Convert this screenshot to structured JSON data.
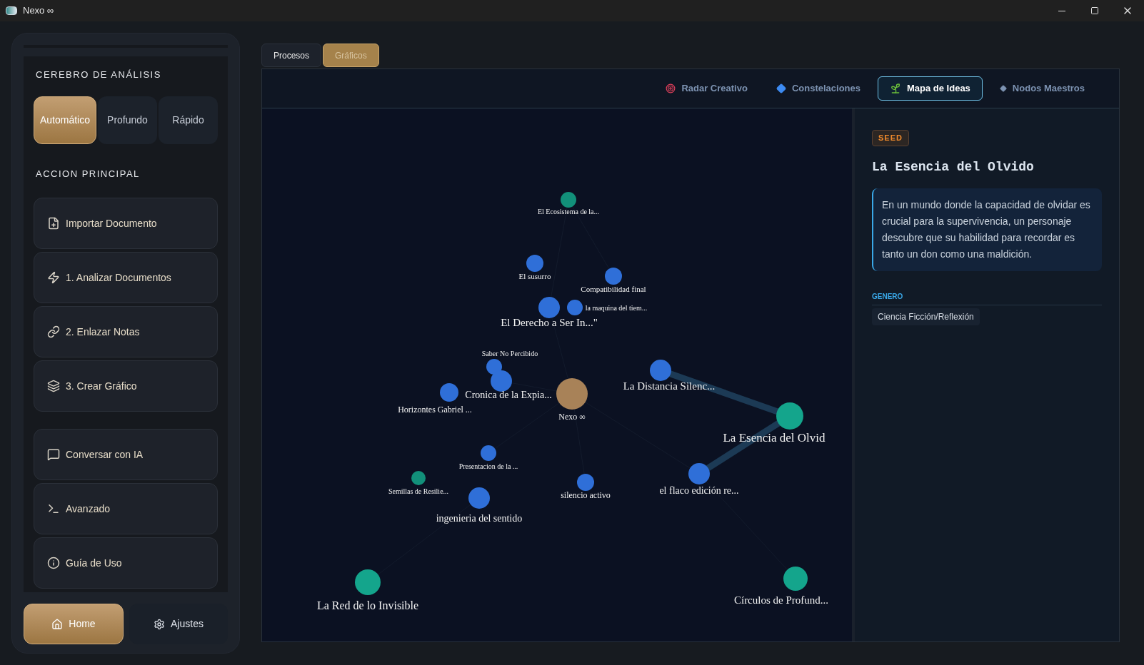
{
  "window": {
    "title": "Nexo ∞"
  },
  "sidebar": {
    "section_title": "CEREBRO DE ANÁLISIS",
    "modes": [
      {
        "label": "Automático",
        "selected": true
      },
      {
        "label": "Profundo",
        "selected": false
      },
      {
        "label": "Rápido",
        "selected": false
      }
    ],
    "actions_title": "ACCION PRINCIPAL",
    "actions": [
      {
        "label": "Importar Documento",
        "kind": "import"
      },
      {
        "label": "1. Analizar Documentos",
        "kind": "analyze"
      },
      {
        "label": "2. Enlazar Notas",
        "kind": "link"
      },
      {
        "label": "3. Crear Gráfico",
        "kind": "layers"
      },
      {
        "label": "Conversar con IA",
        "kind": "chat"
      },
      {
        "label": "Avanzado",
        "kind": "terminal"
      },
      {
        "label": "Guía de Uso",
        "kind": "info"
      }
    ],
    "footer": [
      {
        "label": "Home",
        "kind": "home",
        "selected": true
      },
      {
        "label": "Ajustes",
        "kind": "settings",
        "selected": false
      }
    ]
  },
  "tabs": [
    {
      "label": "Procesos",
      "selected": false
    },
    {
      "label": "Gráficos",
      "selected": true
    }
  ],
  "views": [
    {
      "label": "Radar Creativo",
      "kind": "target",
      "selected": false
    },
    {
      "label": "Constelaciones",
      "kind": "diamond",
      "selected": false
    },
    {
      "label": "Mapa de Ideas",
      "kind": "sprout",
      "selected": true
    },
    {
      "label": "Nodos Maestros",
      "kind": "dot",
      "selected": false
    }
  ],
  "graph": {
    "nodes": [
      {
        "label": "El Ecosistema de la...",
        "color": "#12907a"
      },
      {
        "label": "El susurro",
        "color": "#2f6fd8"
      },
      {
        "label": "Compatibilidad final",
        "color": "#2f6fd8"
      },
      {
        "label": "El Derecho a Ser In...\"",
        "color": "#2f6fd8"
      },
      {
        "label": "la maquina del tiem...",
        "color": "#2f6fd8"
      },
      {
        "label": "Saber No Percibido",
        "color": "#2f6fd8"
      },
      {
        "label": "Cronica de la Expia...",
        "color": "#2f6fd8"
      },
      {
        "label": "Horizontes Gabriel ...",
        "color": "#2f6fd8"
      },
      {
        "label": "Nexo ∞",
        "color": "#a88258"
      },
      {
        "label": "La Distancia Silenc...",
        "color": "#2f6fd8"
      },
      {
        "label": "La Esencia del Olvid",
        "color": "#14a58c"
      },
      {
        "label": "Presentacion de la ...",
        "color": "#2f6fd8"
      },
      {
        "label": "Semillas de Resilie...",
        "color": "#12907a"
      },
      {
        "label": "ingenieria del sentido",
        "color": "#2f6fd8"
      },
      {
        "label": "silencio activo",
        "color": "#2f6fd8"
      },
      {
        "label": "el flaco edición re...",
        "color": "#2f6fd8"
      },
      {
        "label": "La Red de lo Invisible",
        "color": "#14a58c"
      },
      {
        "label": "Círculos de Profund...",
        "color": "#14a58c"
      }
    ]
  },
  "detail": {
    "tag": "SEED",
    "title": "La Esencia del Olvido",
    "description": "En un mundo donde la capacidad de olvidar es crucial para la supervivencia, un personaje descubre que su habilidad para recordar es tanto un don como una maldición.",
    "genre_label": "GENERO",
    "genre": "Ciencia Ficción/Reflexión"
  }
}
